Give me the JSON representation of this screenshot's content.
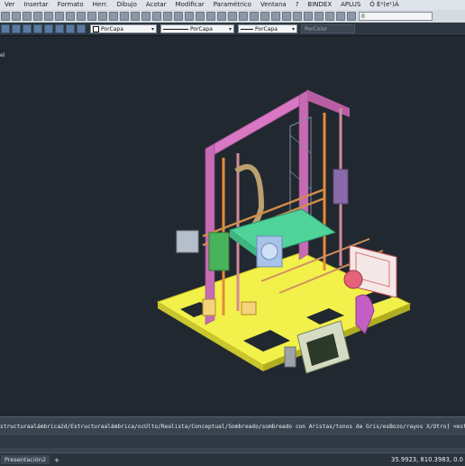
{
  "menubar": {
    "items": [
      "Ver",
      "Insertar",
      "Formato",
      "Herr.",
      "Dibujo",
      "Acotar",
      "Modificar",
      "Paramétrico",
      "Ventana",
      "?",
      "BINDEX",
      "APLUS",
      "Ó È²(e¹)Á"
    ]
  },
  "toolbar_top": {
    "layer_value": "0"
  },
  "toolbar_props": {
    "color_value": "PorCapa",
    "linetype_value": "PorCapa",
    "lineweight_value": "PorCapa",
    "plotstyle_value": "PorColor"
  },
  "viewport": {
    "label": "el"
  },
  "command": {
    "history_text": "structuraalámbrica2d/Estructuraalámbrica/ocUlto/Realista/Conceptual/Sombreado/sombreado con Aristas/tonos de Gris/esBozo/rayos X/Otro] <estructu"
  },
  "statusbar": {
    "tab_label": "Presentación2",
    "add_tab": "+",
    "coordinates": "35.9923, 810.3983, 0.0"
  },
  "colors": {
    "background": "#212830",
    "frame_magenta": "#d977c4",
    "base_yellow": "#f2f04a",
    "bed_green": "#4fd39a"
  }
}
